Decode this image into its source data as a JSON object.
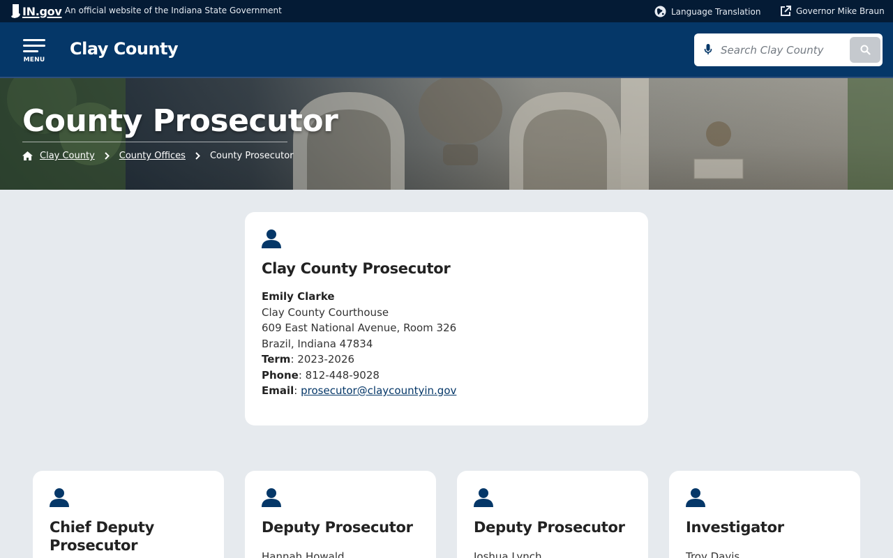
{
  "topbar": {
    "logo_text": "IN.gov",
    "official_text": "An official website of the Indiana State Government",
    "language_label": "Language Translation",
    "governor_label": "Governor Mike Braun"
  },
  "header": {
    "menu_label": "MENU",
    "site_title": "Clay County",
    "search_placeholder": "Search Clay County"
  },
  "hero": {
    "title": "County Prosecutor",
    "breadcrumb": [
      "Clay County",
      "County Offices",
      "County Prosecutor"
    ]
  },
  "main_card": {
    "title": "Clay County Prosecutor",
    "name": "Emily Clarke",
    "address_line1": "Clay County Courthouse",
    "address_line2": "609 East National Avenue, Room 326",
    "address_line3": "Brazil, Indiana 47834",
    "term_label": "Term",
    "term_value": ": 2023-2026",
    "phone_label": "Phone",
    "phone_value": ": 812-448-9028",
    "email_label": "Email",
    "email_value": "prosecutor@claycountyin.gov"
  },
  "staff_cards": [
    {
      "title": "Chief Deputy Prosecutor",
      "name": ""
    },
    {
      "title": "Deputy Prosecutor",
      "name": "Hannah Howald"
    },
    {
      "title": "Deputy Prosecutor",
      "name": "Joshua Lynch"
    },
    {
      "title": "Investigator",
      "name": "Troy Davis"
    }
  ],
  "colors": {
    "topbar_bg": "#041b35",
    "header_bg": "#053768",
    "page_bg": "#e6eaee",
    "link": "#053768"
  }
}
